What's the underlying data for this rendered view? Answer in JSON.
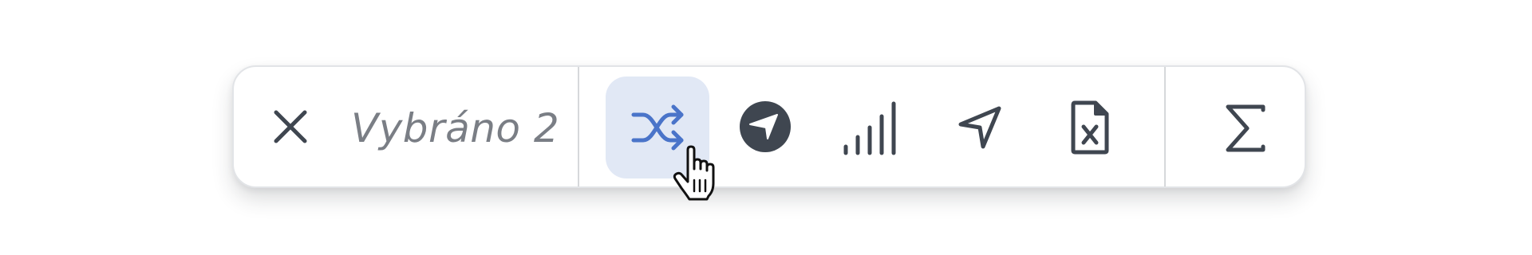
{
  "toolbar": {
    "selection_label": "Vybráno 2",
    "buttons": [
      {
        "name": "close",
        "icon": "close-icon"
      },
      {
        "name": "shuffle",
        "icon": "shuffle-icon",
        "active": true
      },
      {
        "name": "navigation-circle",
        "icon": "navigation-circle-icon"
      },
      {
        "name": "signal-bars",
        "icon": "signal-bars-icon"
      },
      {
        "name": "send-location",
        "icon": "navigation-arrow-icon"
      },
      {
        "name": "excel-file",
        "icon": "file-excel-icon"
      },
      {
        "name": "sum",
        "icon": "sigma-icon"
      }
    ]
  },
  "colors": {
    "icon": "#3f4650",
    "accent": "#4a74c9",
    "active_bg": "#e1e8f5",
    "label": "#7a7e85",
    "border": "#e2e4e7"
  },
  "cursor": "hand-pointer-icon"
}
